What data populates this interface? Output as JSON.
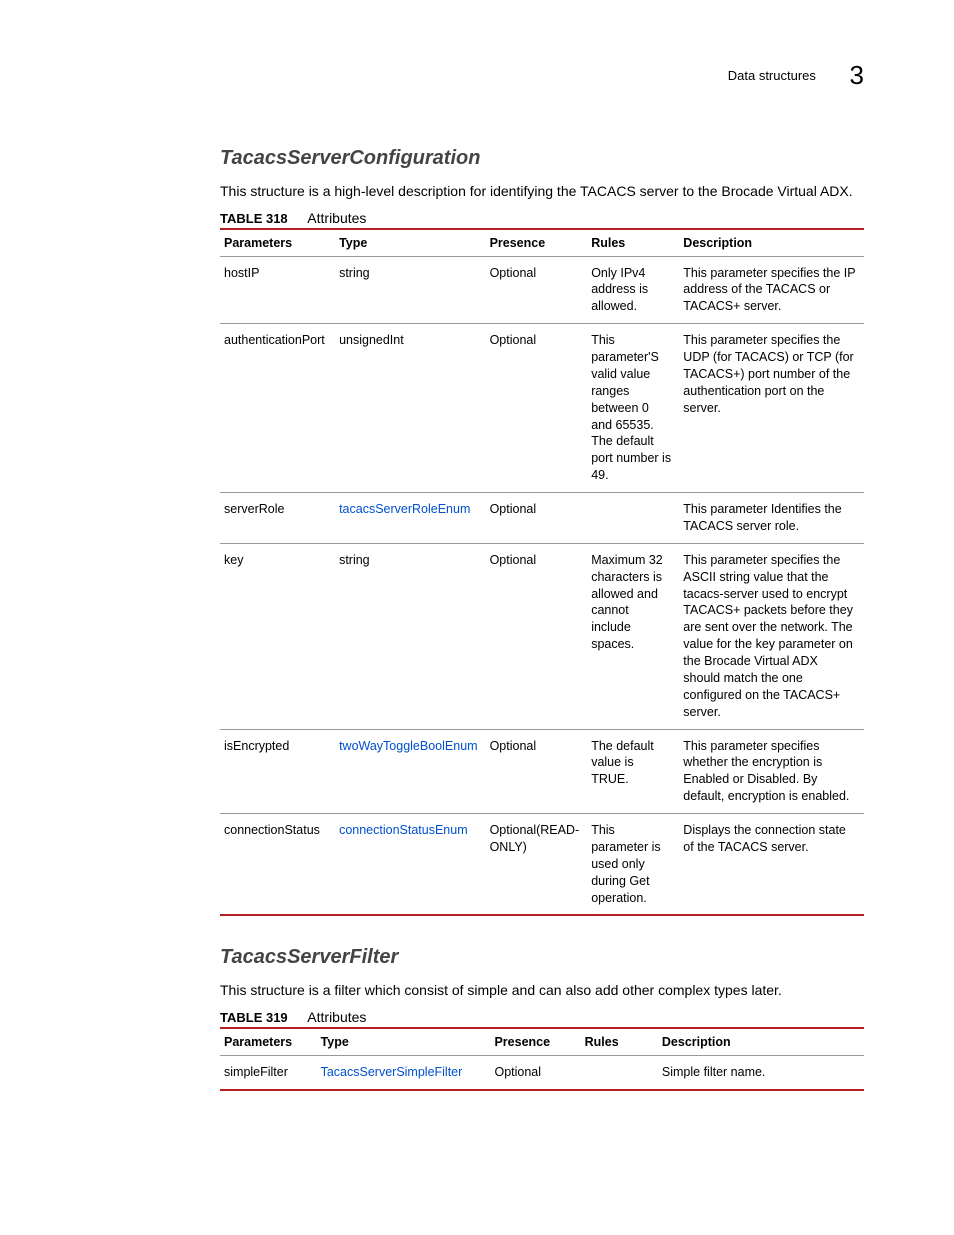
{
  "header": {
    "section_label": "Data structures",
    "chapter_num": "3"
  },
  "section1": {
    "title": "TacacsServerConfiguration",
    "body": "This structure is a high-level description for identifying the TACACS server to the Brocade Virtual ADX.",
    "table_label": "TABLE 318",
    "table_caption": "Attributes",
    "cols": [
      "Parameters",
      "Type",
      "Presence",
      "Rules",
      "Description"
    ],
    "rows": [
      {
        "param": "hostIP",
        "type": "string",
        "type_link": false,
        "presence": "Optional",
        "rules": "Only IPv4 address is allowed.",
        "desc": "This parameter specifies the IP address of the TACACS or TACACS+ server."
      },
      {
        "param": "authenticationPort",
        "type": "unsignedInt",
        "type_link": false,
        "presence": "Optional",
        "rules": "This parameter'S valid value ranges between 0 and 65535. The default port number is 49.",
        "desc": "This parameter specifies the UDP (for TACACS) or TCP (for TACACS+) port number of the authentication port on the server."
      },
      {
        "param": "serverRole",
        "type": "tacacsServerRoleEnum",
        "type_link": true,
        "presence": "Optional",
        "rules": "",
        "desc": "This parameter Identifies the TACACS server role."
      },
      {
        "param": "key",
        "type": "string",
        "type_link": false,
        "presence": "Optional",
        "rules": "Maximum 32 characters is allowed and cannot include spaces.",
        "desc": "This parameter specifies the ASCII string value that the tacacs-server used to encrypt TACACS+ packets before they are sent over the network. The value for the key parameter on the Brocade Virtual ADX should match the one configured on the TACACS+ server."
      },
      {
        "param": "isEncrypted",
        "type": "twoWayToggleBoolEnum",
        "type_link": true,
        "presence": "Optional",
        "rules": "The default value is TRUE.",
        "desc": "This parameter specifies whether the encryption is Enabled or Disabled. By default, encryption is enabled."
      },
      {
        "param": "connectionStatus",
        "type": "connectionStatusEnum",
        "type_link": true,
        "presence": "Optional(READ-ONLY)",
        "rules": "This parameter is used only during Get operation.",
        "desc": "Displays the connection state of the TACACS server."
      }
    ]
  },
  "section2": {
    "title": "TacacsServerFilter",
    "body": "This structure is a filter which consist of simple and can also add other complex types later.",
    "table_label": "TABLE 319",
    "table_caption": "Attributes",
    "cols": [
      "Parameters",
      "Type",
      "Presence",
      "Rules",
      "Description"
    ],
    "rows": [
      {
        "param": "simpleFilter",
        "type": "TacacsServerSimpleFilter",
        "type_link": true,
        "presence": "Optional",
        "rules": "",
        "desc": "Simple filter name."
      }
    ]
  }
}
